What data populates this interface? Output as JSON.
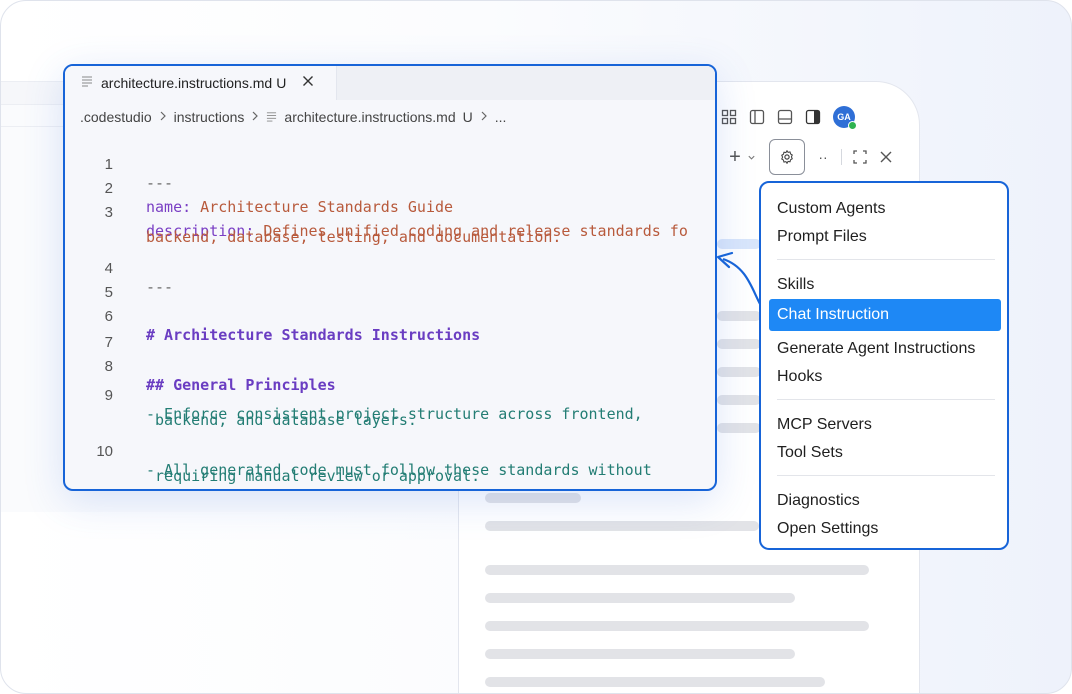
{
  "editor": {
    "tab": {
      "filename": "architecture.instructions.md",
      "status": "U"
    },
    "breadcrumb": {
      "parts": [
        ".codestudio",
        "instructions",
        "architecture.instructions.md",
        "U",
        "..."
      ]
    },
    "lines": [
      {
        "num": "1",
        "dash": "---"
      },
      {
        "num": "2",
        "key": "name:",
        "value": " Architecture Standards Guide"
      },
      {
        "num": "3",
        "key": "description:",
        "value": " Defines unified coding and release standards fo",
        "cont": "backend, database, testing, and documentation."
      },
      {
        "num": "4",
        "dash": "---"
      },
      {
        "num": "5"
      },
      {
        "num": "6",
        "heading": "# Architecture Standards Instructions"
      },
      {
        "num": "7"
      },
      {
        "num": "8",
        "heading": "## General Principles"
      },
      {
        "num": "9",
        "text": "- Enforce consistent project structure across frontend,",
        "cont": " backend, and database layers."
      },
      {
        "num": "10",
        "text": "- All generated code must follow these standards without",
        "cont": " requiring manual review or approval."
      }
    ]
  },
  "chat_header": {
    "avatar_initials": "GA"
  },
  "menu": {
    "groups": [
      [
        "Custom Agents",
        "Prompt Files"
      ],
      [
        "Skills",
        "Chat Instruction",
        "Generate Agent Instructions",
        "Hooks"
      ],
      [
        "MCP Servers",
        "Tool Sets"
      ],
      [
        "Diagnostics",
        "Open Settings"
      ]
    ],
    "selected": "Chat Instruction"
  },
  "colors": {
    "accent": "#1764d8",
    "selection": "#1e88f5"
  }
}
